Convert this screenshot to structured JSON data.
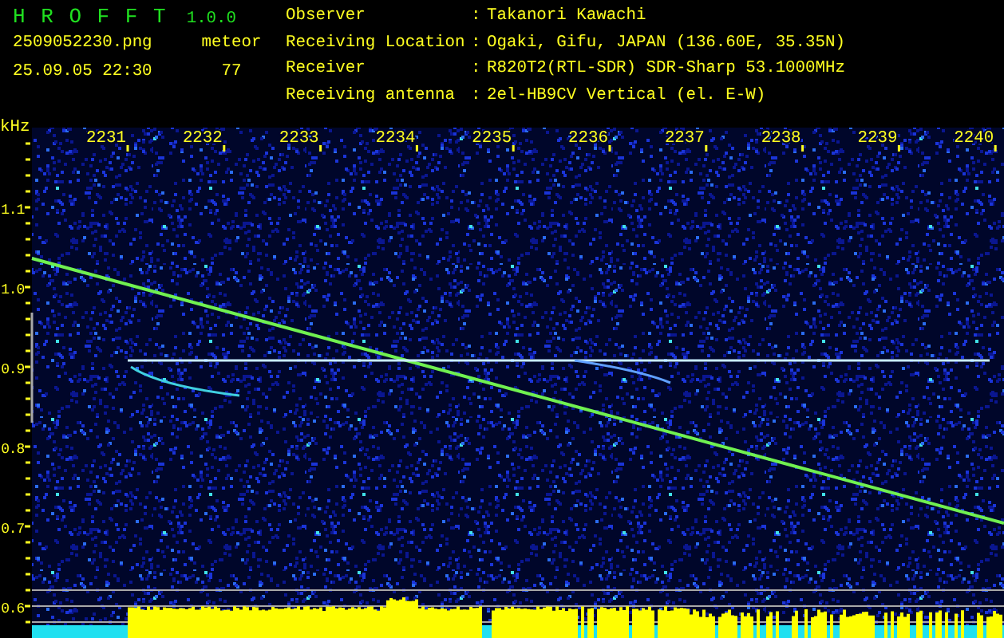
{
  "app": {
    "name": "H R O F F T",
    "version": "1.0.0"
  },
  "file": "2509052230.png",
  "timestamp": "25.09.05 22:30",
  "counter": {
    "label": "meteor",
    "value": "77"
  },
  "station": [
    {
      "label": "Observer",
      "separator": ":",
      "value": "Takanori Kawachi"
    },
    {
      "label": "Receiving Location",
      "separator": ":",
      "value": "Ogaki, Gifu, JAPAN (136.60E, 35.35N)"
    },
    {
      "label": "Receiver",
      "separator": ":",
      "value": "R820T2(RTL-SDR) SDR-Sharp 53.1000MHz"
    },
    {
      "label": "Receiving antenna",
      "separator": ":",
      "value": "2el-HB9CV Vertical (el. E-W)"
    }
  ],
  "spectrogram": {
    "unit": "kHz",
    "y_labels": [
      "1.1",
      "1.0",
      "0.9",
      "0.8",
      "0.7",
      "0.6"
    ],
    "x_labels": [
      "2231",
      "2232",
      "2233",
      "2234",
      "2235",
      "2236",
      "2237",
      "2238",
      "2239",
      "2240"
    ]
  }
}
